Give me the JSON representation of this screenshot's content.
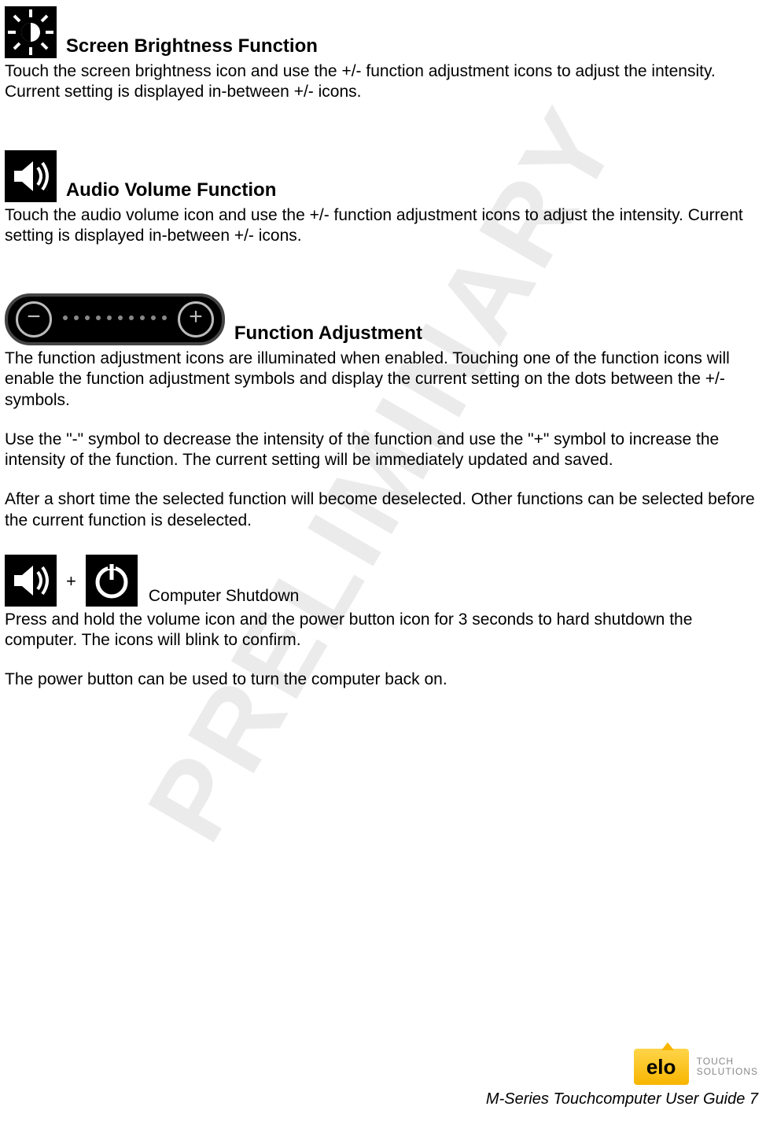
{
  "watermark": "PRELIMINARY",
  "sections": {
    "brightness": {
      "heading": "Screen Brightness Function",
      "body": "Touch the screen brightness icon and use the +/- function adjustment icons to adjust the intensity. Current setting is displayed in-between +/- icons."
    },
    "volume": {
      "heading": "Audio Volume Function",
      "body": "Touch the audio volume icon and use the +/- function adjustment icons to adjust the intensity. Current setting is displayed in-between +/- icons."
    },
    "adjustment": {
      "heading": "Function Adjustment",
      "p1": "The function adjustment icons are illuminated when enabled.  Touching one of the function icons will enable the function adjustment symbols and display the current setting on the dots between the +/- symbols.",
      "p2": "Use the \"-\" symbol to decrease the intensity of the function and use the \"+\" symbol to increase the intensity of the function.  The current setting will be immediately updated and saved.",
      "p3": "After a short time the selected function will become deselected.  Other functions can be selected before the current function is deselected."
    },
    "shutdown": {
      "plus": "+",
      "heading": "Computer Shutdown",
      "p1": "Press and hold the volume icon and the power button icon for 3 seconds to hard shutdown the computer.  The icons will blink to confirm.",
      "p2": "The power button can be used to turn the computer back on."
    }
  },
  "footer": {
    "logo_text": "elo",
    "logo_sub1": "TOUCH",
    "logo_sub2": "SOLUTIONS",
    "line": "M-Series Touchcomputer User Guide 7"
  }
}
